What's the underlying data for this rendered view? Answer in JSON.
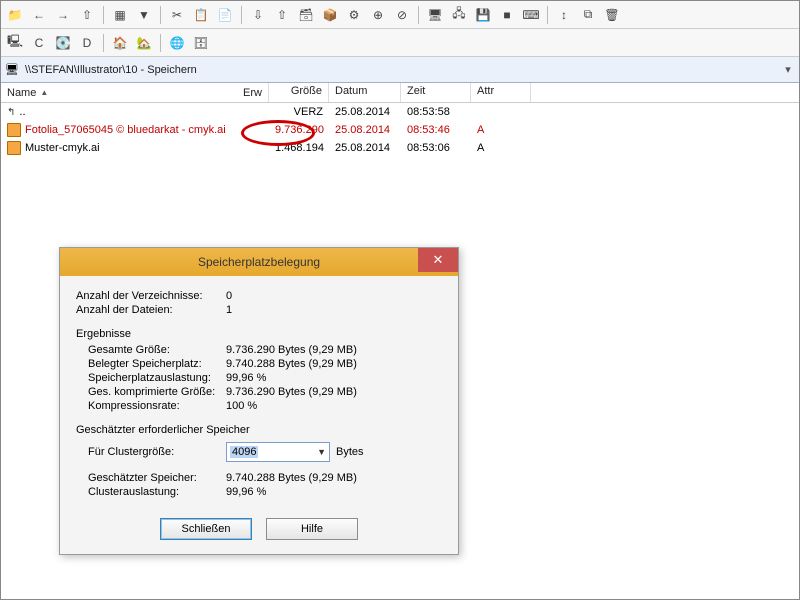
{
  "toolbar1_icons": [
    "📁",
    "←",
    "→",
    "⇧",
    "│",
    "▦",
    "▼",
    "│",
    "✂",
    "📋",
    "📄",
    "│",
    "⇩",
    "⇧",
    "🗃",
    "📦",
    "⚙",
    "⊕",
    "⊘",
    "│",
    "🖥",
    "🖧",
    "💾",
    "■",
    "⌨",
    "│",
    "↕",
    "⧉",
    "🗑"
  ],
  "toolbar2_icons": [
    "🖳",
    "C",
    "💽",
    "D",
    "│",
    "🏠",
    "🏡",
    "│",
    "🌐",
    "🗄"
  ],
  "path": "\\\\STEFAN\\Illustrator\\10 - Speichern",
  "columns": {
    "name": "Name",
    "ext": "Erw",
    "size": "Größe",
    "date": "Datum",
    "time": "Zeit",
    "attr": "Attr"
  },
  "rows": [
    {
      "name": "..",
      "is_dir": true,
      "size": "VERZ",
      "date": "25.08.2014",
      "time": "08:53:58",
      "attr": "",
      "selected": false,
      "icon": "up"
    },
    {
      "name": "Fotolia_57065045 © bluedarkat - cmyk.ai",
      "is_dir": false,
      "size": "9.736.290",
      "date": "25.08.2014",
      "time": "08:53:46",
      "attr": "A",
      "selected": true,
      "icon": "ai"
    },
    {
      "name": "Muster-cmyk.ai",
      "is_dir": false,
      "size": "1.468.194",
      "date": "25.08.2014",
      "time": "08:53:06",
      "attr": "A",
      "selected": false,
      "icon": "ai"
    }
  ],
  "dialog": {
    "title": "Speicherplatzbelegung",
    "counts": {
      "dirs_label": "Anzahl der Verzeichnisse:",
      "dirs_value": "0",
      "files_label": "Anzahl der Dateien:",
      "files_value": "1"
    },
    "results_label": "Ergebnisse",
    "results": {
      "total_label": "Gesamte Größe:",
      "total_value": "9.736.290 Bytes (9,29 MB)",
      "used_label": "Belegter Speicherplatz:",
      "used_value": "9.740.288 Bytes (9,29 MB)",
      "usage_label": "Speicherplatzauslastung:",
      "usage_value": "99,96 %",
      "comp_label": "Ges. komprimierte Größe:",
      "comp_value": "9.736.290 Bytes (9,29 MB)",
      "ratio_label": "Kompressionsrate:",
      "ratio_value": "100 %"
    },
    "estimate_label": "Geschätzter erforderlicher Speicher",
    "cluster": {
      "label": "Für Clustergröße:",
      "value": "4096",
      "unit": "Bytes"
    },
    "estimate": {
      "est_label": "Geschätzter Speicher:",
      "est_value": "9.740.288 Bytes (9,29 MB)",
      "cluster_usage_label": "Clusterauslastung:",
      "cluster_usage_value": "99,96 %"
    },
    "buttons": {
      "close": "Schließen",
      "help": "Hilfe"
    }
  }
}
